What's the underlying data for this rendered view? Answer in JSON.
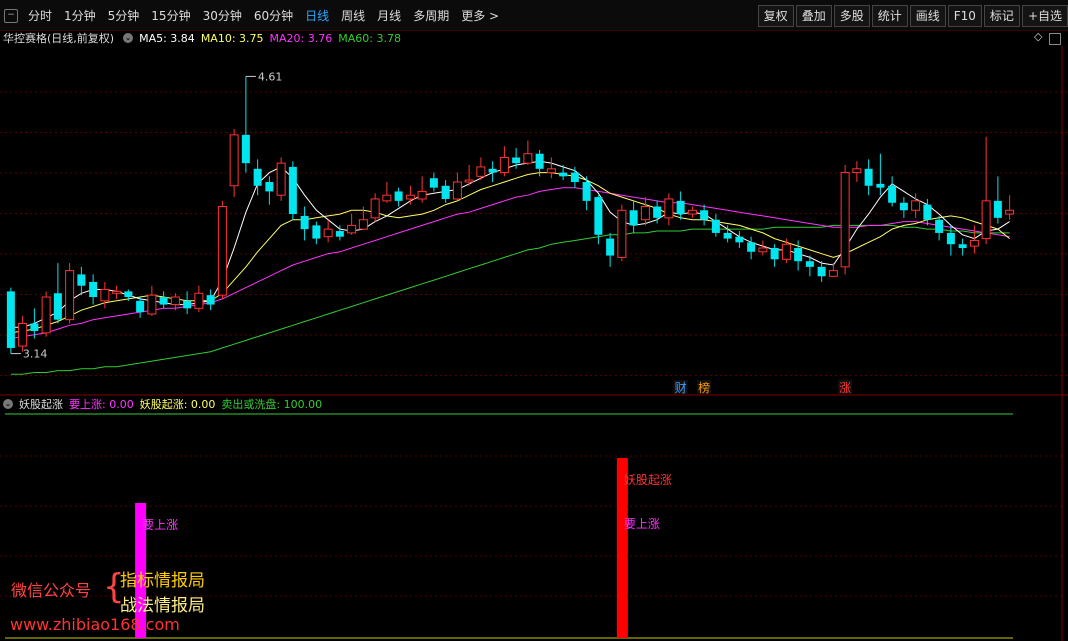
{
  "toolbar": {
    "tabs": [
      "分时",
      "1分钟",
      "5分钟",
      "15分钟",
      "30分钟",
      "60分钟",
      "日线",
      "周线",
      "月线",
      "多周期",
      "更多 >"
    ],
    "active_tab": "日线",
    "right_buttons": [
      "复权",
      "叠加",
      "多股",
      "统计",
      "画线",
      "F10",
      "标记",
      "+自选"
    ]
  },
  "main_chart": {
    "title": "华控赛格(日线,前复权)",
    "ma5_label": "MA5: 3.84",
    "ma10_label": "MA10: 3.75",
    "ma20_label": "MA20: 3.76",
    "ma60_label": "MA60: 3.78",
    "high_label": "4.61",
    "low_label": "3.14",
    "price_range": [
      3.0,
      4.75
    ],
    "event_markers": [
      {
        "index": 57,
        "text": "财",
        "color": "#3aa0ff"
      },
      {
        "index": 59,
        "text": "榜",
        "color": "#ff9900"
      },
      {
        "index": 71,
        "text": "涨",
        "color": "#ff3333"
      }
    ]
  },
  "colors": {
    "up": "#ff3333",
    "down": "#00e5ee",
    "ma5": "#ffffff",
    "ma10": "#ffff66",
    "ma20": "#ff33ff",
    "ma60": "#33cc33",
    "signal_magenta": "#ff00ff",
    "signal_red": "#ff0000",
    "indicator_line": "#33cc33"
  },
  "candles": [
    [
      3.47,
      3.17,
      3.49,
      3.14
    ],
    [
      3.18,
      3.3,
      3.34,
      3.15
    ],
    [
      3.3,
      3.26,
      3.38,
      3.22
    ],
    [
      3.25,
      3.44,
      3.47,
      3.23
    ],
    [
      3.46,
      3.32,
      3.62,
      3.3
    ],
    [
      3.32,
      3.58,
      3.62,
      3.3
    ],
    [
      3.56,
      3.5,
      3.6,
      3.45
    ],
    [
      3.52,
      3.44,
      3.56,
      3.4
    ],
    [
      3.42,
      3.48,
      3.52,
      3.38
    ],
    [
      3.46,
      3.47,
      3.5,
      3.43
    ],
    [
      3.47,
      3.44,
      3.48,
      3.42
    ],
    [
      3.42,
      3.36,
      3.44,
      3.33
    ],
    [
      3.35,
      3.45,
      3.5,
      3.34
    ],
    [
      3.44,
      3.4,
      3.47,
      3.38
    ],
    [
      3.4,
      3.44,
      3.46,
      3.37
    ],
    [
      3.42,
      3.38,
      3.47,
      3.35
    ],
    [
      3.38,
      3.46,
      3.5,
      3.36
    ],
    [
      3.45,
      3.4,
      3.48,
      3.37
    ],
    [
      3.45,
      3.92,
      3.95,
      3.43
    ],
    [
      4.03,
      4.3,
      4.33,
      3.97
    ],
    [
      4.3,
      4.15,
      4.61,
      4.1
    ],
    [
      4.12,
      4.03,
      4.17,
      3.98
    ],
    [
      4.05,
      4.0,
      4.08,
      3.93
    ],
    [
      3.98,
      4.15,
      4.18,
      3.95
    ],
    [
      4.13,
      3.88,
      4.16,
      3.85
    ],
    [
      3.87,
      3.8,
      3.92,
      3.74
    ],
    [
      3.82,
      3.75,
      3.84,
      3.72
    ],
    [
      3.76,
      3.8,
      3.85,
      3.73
    ],
    [
      3.79,
      3.76,
      3.82,
      3.74
    ],
    [
      3.78,
      3.82,
      3.88,
      3.77
    ],
    [
      3.8,
      3.85,
      3.92,
      3.8
    ],
    [
      3.86,
      3.96,
      3.99,
      3.84
    ],
    [
      3.95,
      3.98,
      4.05,
      3.94
    ],
    [
      4.0,
      3.95,
      4.02,
      3.92
    ],
    [
      3.96,
      3.98,
      4.03,
      3.93
    ],
    [
      3.96,
      4.0,
      4.08,
      3.94
    ],
    [
      4.07,
      4.02,
      4.1,
      4.0
    ],
    [
      4.03,
      3.96,
      4.06,
      3.94
    ],
    [
      3.96,
      4.05,
      4.1,
      3.95
    ],
    [
      4.05,
      4.06,
      4.14,
      4.03
    ],
    [
      4.08,
      4.13,
      4.18,
      4.06
    ],
    [
      4.12,
      4.1,
      4.16,
      4.05
    ],
    [
      4.1,
      4.18,
      4.24,
      4.08
    ],
    [
      4.18,
      4.15,
      4.23,
      4.12
    ],
    [
      4.15,
      4.2,
      4.27,
      4.14
    ],
    [
      4.2,
      4.12,
      4.22,
      4.08
    ],
    [
      4.1,
      4.12,
      4.18,
      4.07
    ],
    [
      4.1,
      4.08,
      4.14,
      4.06
    ],
    [
      4.1,
      4.05,
      4.13,
      4.02
    ],
    [
      4.05,
      3.95,
      4.08,
      3.9
    ],
    [
      3.97,
      3.77,
      3.98,
      3.72
    ],
    [
      3.75,
      3.66,
      3.78,
      3.6
    ],
    [
      3.65,
      3.9,
      3.93,
      3.63
    ],
    [
      3.9,
      3.82,
      3.95,
      3.78
    ],
    [
      3.85,
      3.92,
      3.97,
      3.82
    ],
    [
      3.92,
      3.86,
      3.95,
      3.83
    ],
    [
      3.86,
      3.96,
      3.99,
      3.82
    ],
    [
      3.95,
      3.88,
      4.0,
      3.85
    ],
    [
      3.88,
      3.9,
      3.92,
      3.86
    ],
    [
      3.9,
      3.85,
      3.93,
      3.82
    ],
    [
      3.85,
      3.78,
      3.88,
      3.76
    ],
    [
      3.78,
      3.75,
      3.82,
      3.73
    ],
    [
      3.76,
      3.73,
      3.79,
      3.7
    ],
    [
      3.73,
      3.68,
      3.76,
      3.64
    ],
    [
      3.68,
      3.7,
      3.74,
      3.66
    ],
    [
      3.7,
      3.64,
      3.72,
      3.6
    ],
    [
      3.64,
      3.72,
      3.75,
      3.62
    ],
    [
      3.7,
      3.63,
      3.74,
      3.58
    ],
    [
      3.63,
      3.6,
      3.66,
      3.55
    ],
    [
      3.6,
      3.55,
      3.63,
      3.52
    ],
    [
      3.55,
      3.58,
      3.62,
      3.55
    ],
    [
      3.6,
      4.1,
      4.14,
      3.56
    ],
    [
      4.1,
      4.12,
      4.16,
      4.05
    ],
    [
      4.12,
      4.03,
      4.17,
      3.98
    ],
    [
      4.04,
      4.02,
      4.2,
      3.98
    ],
    [
      4.03,
      3.94,
      4.08,
      3.92
    ],
    [
      3.94,
      3.9,
      3.97,
      3.86
    ],
    [
      3.9,
      3.95,
      3.99,
      3.86
    ],
    [
      3.93,
      3.85,
      3.96,
      3.82
    ],
    [
      3.85,
      3.78,
      3.87,
      3.74
    ],
    [
      3.78,
      3.72,
      3.82,
      3.66
    ],
    [
      3.72,
      3.7,
      3.75,
      3.66
    ],
    [
      3.71,
      3.74,
      3.82,
      3.67
    ],
    [
      3.75,
      3.95,
      4.29,
      3.72
    ],
    [
      3.95,
      3.86,
      4.08,
      3.83
    ],
    [
      3.88,
      3.9,
      3.98,
      3.85
    ]
  ],
  "ma_lines": {
    "ma5": [
      3.28,
      3.28,
      3.3,
      3.33,
      3.36,
      3.42,
      3.46,
      3.48,
      3.48,
      3.47,
      3.45,
      3.43,
      3.42,
      3.41,
      3.4,
      3.4,
      3.41,
      3.42,
      3.53,
      3.7,
      3.89,
      4.04,
      4.1,
      4.13,
      4.07,
      3.98,
      3.9,
      3.85,
      3.8,
      3.79,
      3.8,
      3.84,
      3.87,
      3.91,
      3.95,
      3.98,
      3.99,
      4.0,
      4.01,
      4.04,
      4.07,
      4.1,
      4.12,
      4.14,
      4.15,
      4.16,
      4.15,
      4.13,
      4.11,
      4.06,
      3.99,
      3.89,
      3.84,
      3.82,
      3.83,
      3.85,
      3.89,
      3.88,
      3.89,
      3.88,
      3.84,
      3.8,
      3.76,
      3.73,
      3.71,
      3.69,
      3.69,
      3.67,
      3.65,
      3.62,
      3.61,
      3.7,
      3.8,
      3.88,
      3.97,
      4.04,
      4.0,
      3.96,
      3.93,
      3.88,
      3.82,
      3.77,
      3.75,
      3.79,
      3.8,
      3.84
    ],
    "ma10": [
      3.25,
      3.26,
      3.27,
      3.29,
      3.31,
      3.34,
      3.37,
      3.39,
      3.41,
      3.42,
      3.43,
      3.44,
      3.45,
      3.44,
      3.43,
      3.42,
      3.42,
      3.42,
      3.46,
      3.53,
      3.6,
      3.68,
      3.75,
      3.82,
      3.85,
      3.85,
      3.86,
      3.87,
      3.88,
      3.9,
      3.9,
      3.89,
      3.87,
      3.86,
      3.87,
      3.88,
      3.9,
      3.93,
      3.95,
      3.98,
      4.01,
      4.03,
      4.05,
      4.07,
      4.09,
      4.1,
      4.1,
      4.09,
      4.08,
      4.06,
      4.03,
      3.99,
      3.97,
      3.95,
      3.93,
      3.91,
      3.88,
      3.86,
      3.85,
      3.85,
      3.84,
      3.83,
      3.82,
      3.8,
      3.78,
      3.75,
      3.73,
      3.71,
      3.69,
      3.67,
      3.65,
      3.67,
      3.7,
      3.73,
      3.76,
      3.8,
      3.82,
      3.83,
      3.85,
      3.86,
      3.87,
      3.86,
      3.84,
      3.82,
      3.8,
      3.75
    ],
    "ma20": [
      3.22,
      3.23,
      3.24,
      3.25,
      3.27,
      3.29,
      3.3,
      3.32,
      3.33,
      3.34,
      3.35,
      3.36,
      3.37,
      3.38,
      3.38,
      3.39,
      3.4,
      3.41,
      3.43,
      3.46,
      3.49,
      3.52,
      3.55,
      3.58,
      3.61,
      3.63,
      3.65,
      3.67,
      3.68,
      3.7,
      3.72,
      3.74,
      3.76,
      3.78,
      3.8,
      3.82,
      3.84,
      3.86,
      3.88,
      3.89,
      3.91,
      3.93,
      3.95,
      3.97,
      3.98,
      4.0,
      4.01,
      4.02,
      4.02,
      4.01,
      4.0,
      3.99,
      3.98,
      3.97,
      3.96,
      3.95,
      3.94,
      3.94,
      3.93,
      3.92,
      3.91,
      3.9,
      3.89,
      3.88,
      3.87,
      3.86,
      3.85,
      3.84,
      3.83,
      3.82,
      3.81,
      3.81,
      3.81,
      3.82,
      3.82,
      3.83,
      3.84,
      3.84,
      3.83,
      3.82,
      3.81,
      3.8,
      3.79,
      3.78,
      3.77,
      3.76
    ],
    "ma60": [
      3.03,
      3.03,
      3.04,
      3.04,
      3.05,
      3.05,
      3.06,
      3.06,
      3.07,
      3.07,
      3.08,
      3.09,
      3.1,
      3.11,
      3.12,
      3.13,
      3.14,
      3.15,
      3.17,
      3.19,
      3.21,
      3.23,
      3.25,
      3.27,
      3.29,
      3.31,
      3.33,
      3.35,
      3.37,
      3.39,
      3.41,
      3.43,
      3.45,
      3.47,
      3.49,
      3.51,
      3.53,
      3.55,
      3.57,
      3.59,
      3.61,
      3.63,
      3.65,
      3.67,
      3.69,
      3.7,
      3.72,
      3.73,
      3.74,
      3.75,
      3.76,
      3.77,
      3.77,
      3.78,
      3.78,
      3.79,
      3.79,
      3.79,
      3.8,
      3.8,
      3.8,
      3.8,
      3.8,
      3.8,
      3.8,
      3.81,
      3.81,
      3.81,
      3.81,
      3.81,
      3.82,
      3.82,
      3.82,
      3.82,
      3.82,
      3.82,
      3.81,
      3.81,
      3.8,
      3.8,
      3.79,
      3.79,
      3.78,
      3.78,
      3.78,
      3.78
    ]
  },
  "indicator": {
    "title": "妖股起涨",
    "vals": [
      {
        "label": "要上涨: 0.00",
        "color": "#ff33ff"
      },
      {
        "label": "妖股起涨: 0.00",
        "color": "#ffff66"
      },
      {
        "label": "卖出或洗盘: 100.00",
        "color": "#33cc33"
      }
    ],
    "bars": [
      {
        "index": 11,
        "color": "#ff00ff",
        "value": 0.75,
        "labels": [
          {
            "text": "要上涨",
            "color": "#ff33ff"
          }
        ]
      },
      {
        "index": 52,
        "color": "#ff0000",
        "value": 1.0,
        "labels": [
          {
            "text": "妖股起涨",
            "color": "#ff3333"
          },
          {
            "text": "要上涨",
            "color": "#ff33ff"
          }
        ]
      }
    ]
  },
  "watermark": {
    "left_text": "微信公众号",
    "right_lines": [
      "指标情报局",
      "战法情报局"
    ],
    "url": "www.zhibiao168.com"
  }
}
